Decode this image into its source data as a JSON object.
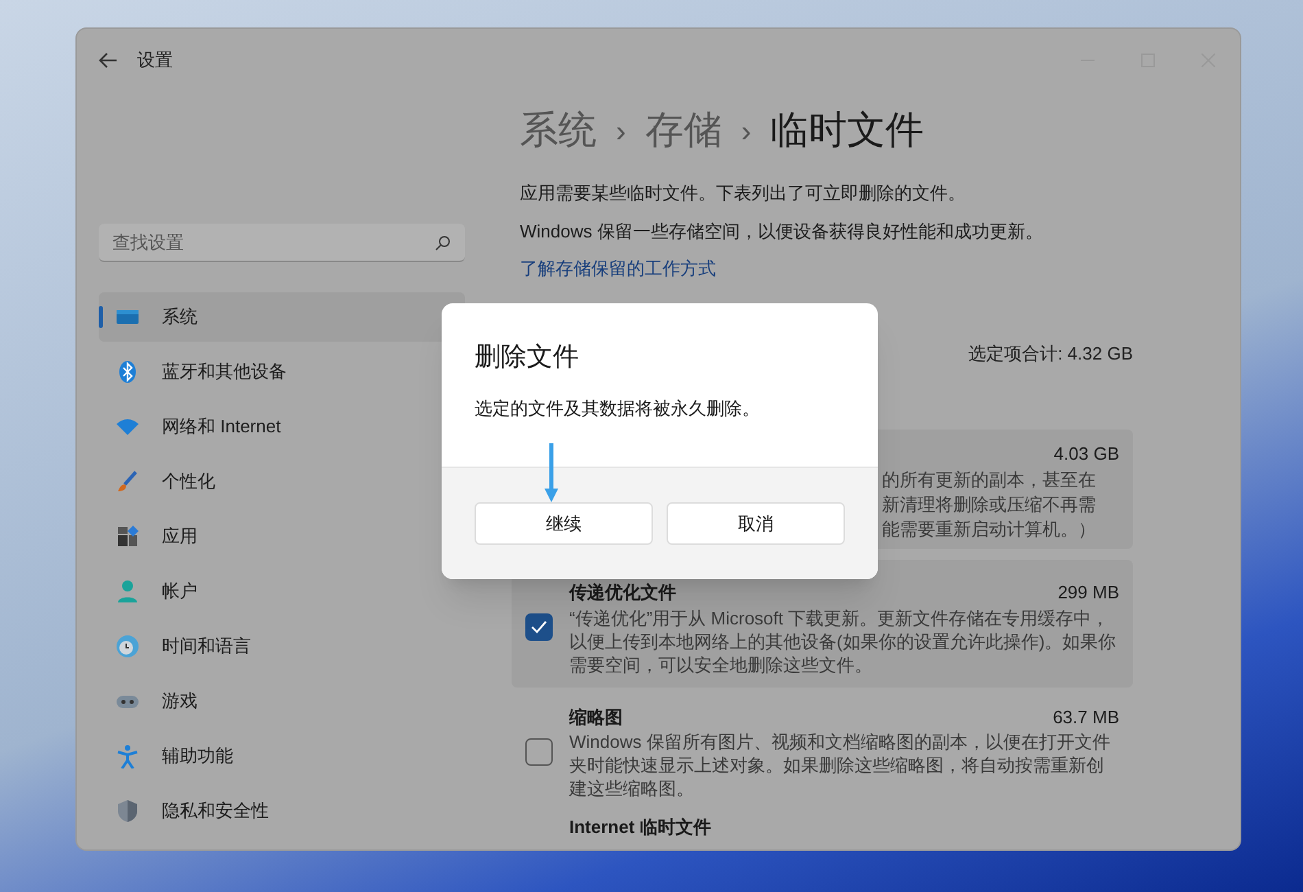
{
  "window": {
    "title": "设置"
  },
  "search": {
    "placeholder": "查找设置"
  },
  "sidebar": {
    "items": [
      {
        "label": "系统",
        "selected": true
      },
      {
        "label": "蓝牙和其他设备",
        "selected": false
      },
      {
        "label": "网络和 Internet",
        "selected": false
      },
      {
        "label": "个性化",
        "selected": false
      },
      {
        "label": "应用",
        "selected": false
      },
      {
        "label": "帐户",
        "selected": false
      },
      {
        "label": "时间和语言",
        "selected": false
      },
      {
        "label": "游戏",
        "selected": false
      },
      {
        "label": "辅助功能",
        "selected": false
      },
      {
        "label": "隐私和安全性",
        "selected": false
      }
    ]
  },
  "breadcrumb": {
    "items": [
      "系统",
      "存储",
      "临时文件"
    ],
    "separators": [
      "›",
      "›"
    ]
  },
  "intro": [
    "应用需要某些临时文件。下表列出了可立即删除的文件。",
    "Windows 保留一些存储空间，以便设备获得良好性能和成功更新。"
  ],
  "link": "了解存储保留的工作方式",
  "total": "选定项合计: 4.32 GB",
  "items": [
    {
      "kind": "covered",
      "size": "4.03 GB",
      "description_lines": [
        "的所有更新的副本，甚至在",
        "新清理将删除或压缩不再需",
        "能需要重新启动计算机。）"
      ]
    },
    {
      "kind": "full",
      "checked": true,
      "title": "传递优化文件",
      "size": "299 MB",
      "description": "“传递优化”用于从 Microsoft 下载更新。更新文件存储在专用缓存中，以便上传到本地网络上的其他设备(如果你的设置允许此操作)。如果你需要空间，可以安全地删除这些文件。"
    },
    {
      "kind": "full",
      "checked": false,
      "title": "缩略图",
      "size": "63.7 MB",
      "description": "Windows 保留所有图片、视频和文档缩略图的副本，以便在打开文件夹时能快速显示上述对象。如果删除这些缩略图，将自动按需重新创建这些缩略图。"
    },
    {
      "kind": "title_only",
      "title": "Internet 临时文件"
    }
  ],
  "dialog": {
    "title": "删除文件",
    "message": "选定的文件及其数据将被永久删除。",
    "buttons": [
      "继续",
      "取消"
    ]
  }
}
